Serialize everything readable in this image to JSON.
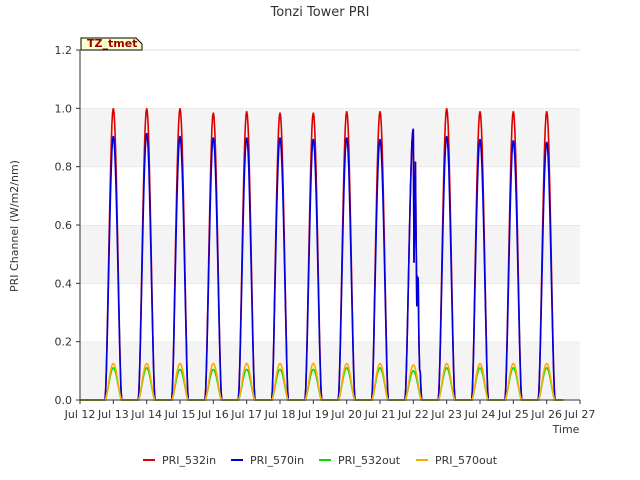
{
  "chart_data": {
    "type": "line",
    "title": "Tonzi Tower PRI",
    "xlabel": "Time",
    "ylabel": "PRI Channel (W/m2/nm)",
    "badge": "TZ_tmet",
    "x_ticks": [
      "Jul 12",
      "Jul 13",
      "Jul 14",
      "Jul 15",
      "Jul 16",
      "Jul 17",
      "Jul 18",
      "Jul 19",
      "Jul 20",
      "Jul 21",
      "Jul 22",
      "Jul 23",
      "Jul 24",
      "Jul 25",
      "Jul 26",
      "Jul 27"
    ],
    "y_ticks": [
      "0.0",
      "0.2",
      "0.4",
      "0.6",
      "0.8",
      "1.0",
      "1.2"
    ],
    "xlim": [
      12,
      27
    ],
    "ylim": [
      0,
      1.2
    ],
    "grid": "horizontal bands",
    "legend_position": "bottom",
    "x_day_start": 12,
    "series": [
      {
        "name": "PRI_532in",
        "color": "#dd0000",
        "peaks": [
          1.0,
          1.0,
          1.0,
          0.985,
          0.99,
          0.985,
          0.985,
          0.99,
          0.99,
          0.93,
          1.0,
          0.99,
          0.99,
          0.99
        ]
      },
      {
        "name": "PRI_570in",
        "color": "#0000dd",
        "peaks": [
          0.905,
          0.915,
          0.905,
          0.9,
          0.9,
          0.9,
          0.895,
          0.9,
          0.895,
          0.93,
          0.905,
          0.895,
          0.89,
          0.885
        ]
      },
      {
        "name": "PRI_532out",
        "color": "#00dd00",
        "peaks": [
          0.11,
          0.11,
          0.105,
          0.105,
          0.105,
          0.105,
          0.105,
          0.11,
          0.11,
          0.1,
          0.11,
          0.11,
          0.11,
          0.11
        ]
      },
      {
        "name": "PRI_570out",
        "color": "#ffaa00",
        "peaks": [
          0.125,
          0.125,
          0.125,
          0.125,
          0.125,
          0.125,
          0.125,
          0.125,
          0.125,
          0.12,
          0.125,
          0.125,
          0.125,
          0.125
        ]
      }
    ]
  }
}
